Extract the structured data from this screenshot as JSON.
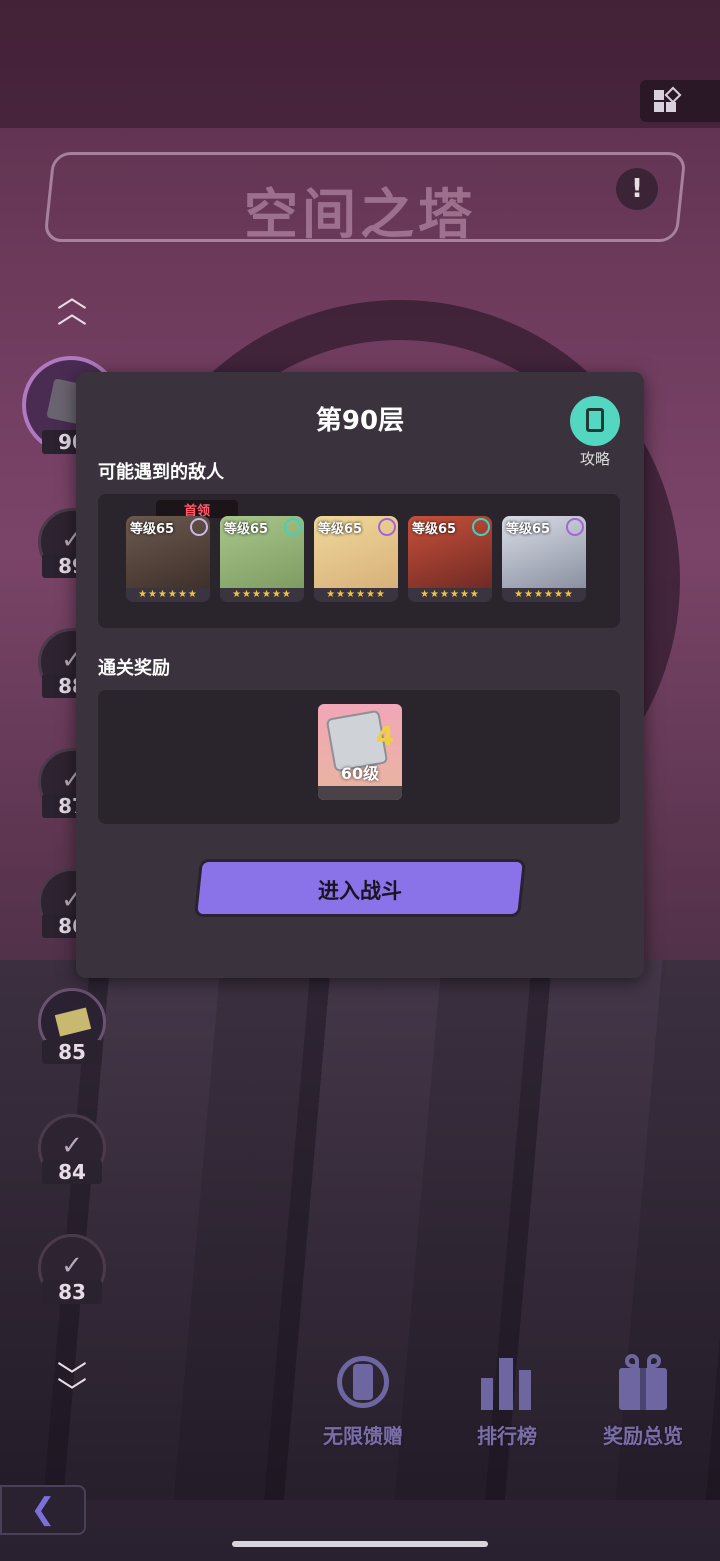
{
  "header": {
    "title": "空间之塔",
    "info_symbol": "!"
  },
  "floors": {
    "current": "90",
    "list": [
      "89",
      "88",
      "87",
      "86",
      "85",
      "84",
      "83"
    ]
  },
  "modal": {
    "title": "第90层",
    "guide_label": "攻略",
    "enemies_heading": "可能遇到的敌人",
    "boss_tag": "首领",
    "enemies": [
      {
        "level": "等级65",
        "stars": "★★★★★★",
        "element_color": "#c9b7e6"
      },
      {
        "level": "等级65",
        "stars": "★★★★★★",
        "element_color": "#3fd2c0"
      },
      {
        "level": "等级65",
        "stars": "★★★★★★",
        "element_color": "#a266d8"
      },
      {
        "level": "等级65",
        "stars": "★★★★★★",
        "element_color": "#3fd2c0"
      },
      {
        "level": "等级65",
        "stars": "★★★★★★",
        "element_color": "#a266d8"
      }
    ],
    "rewards_heading": "通关奖励",
    "reward": {
      "label": "60级",
      "badge": "4"
    },
    "battle_button": "进入战斗"
  },
  "bottom_bar": {
    "gift_label": "无限馈赠",
    "rank_label": "排行榜",
    "rewards_label": "奖励总览"
  },
  "back_symbol": "❮",
  "colors": {
    "accent": "#8a72e8",
    "guide": "#54d7c0",
    "boss": "#ff5a6a"
  }
}
